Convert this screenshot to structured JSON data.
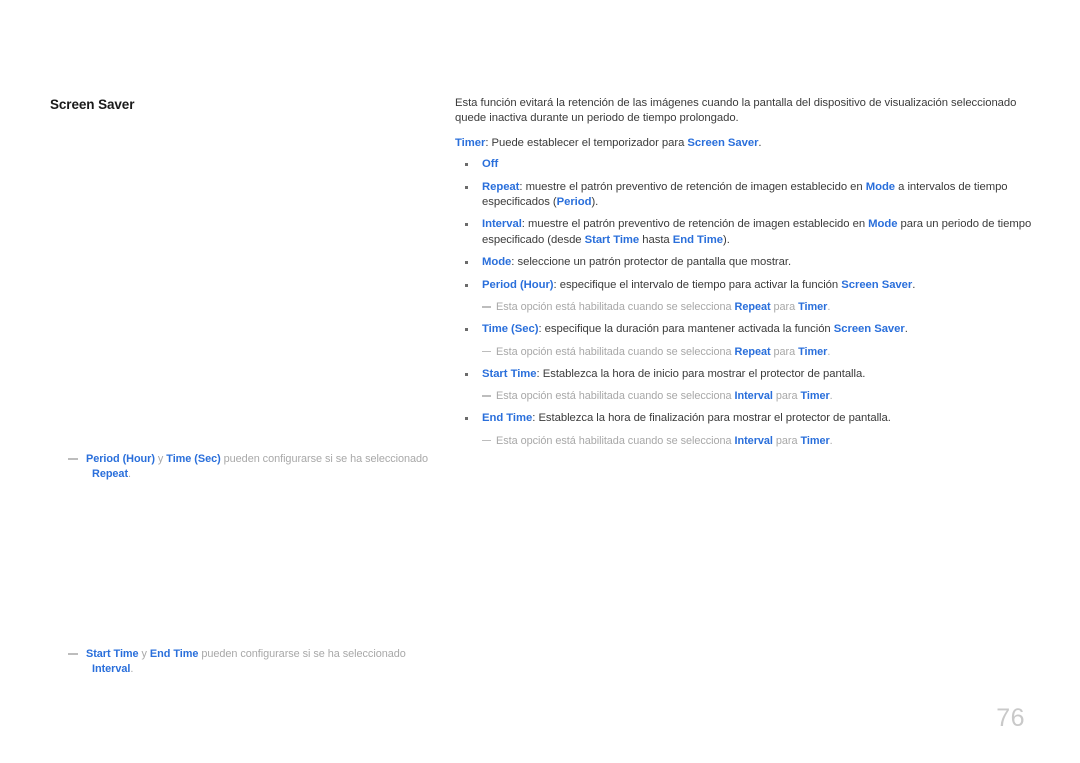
{
  "page": {
    "number": "76",
    "accent_color": "#2a6fdb",
    "body_color": "#3b3b3b",
    "note_color": "#a8a8a8"
  },
  "section": {
    "title": "Screen Saver"
  },
  "intro": {
    "text": "Esta función evitará la retención de las imágenes cuando la pantalla del dispositivo de visualización seleccionado quede inactiva durante un periodo de tiempo prolongado."
  },
  "timer": {
    "term": "Timer",
    "sep": ": ",
    "text_before": "Puede establecer el temporizador para ",
    "ref": "Screen Saver",
    "text_after": "."
  },
  "options": [
    {
      "term": "Off",
      "sep": "",
      "body_1": "",
      "ref_1": "",
      "body_2": "",
      "ref_2": "",
      "body_3": ""
    },
    {
      "term": "Repeat",
      "sep": ": ",
      "body_1": "muestre el patrón preventivo de retención de imagen establecido en ",
      "ref_1": "Mode",
      "body_2": " a intervalos de tiempo especificados (",
      "ref_2": "Period",
      "body_3": ")."
    },
    {
      "term": "Interval",
      "sep": ": ",
      "body_1": "muestre el patrón preventivo de retención de imagen establecido en ",
      "ref_1": "Mode",
      "body_2": " para un periodo de tiempo especificado (desde ",
      "ref_2": "Start Time",
      "body_3": " hasta ",
      "ref_3": "End Time",
      "body_4": ")."
    },
    {
      "term": "Mode",
      "sep": ": ",
      "body_1": "seleccione un patrón protector de pantalla que mostrar.",
      "ref_1": "",
      "body_2": ""
    },
    {
      "term": "Period (Hour)",
      "sep": ": ",
      "body_1": "especifique el intervalo de tiempo para activar la función ",
      "ref_1": "Screen Saver",
      "body_2": "."
    },
    {
      "term": "Time (Sec)",
      "sep": ": ",
      "body_1": "especifique la duración para mantener activada la función ",
      "ref_1": "Screen Saver",
      "body_2": "."
    },
    {
      "term": "Start Time",
      "sep": ": ",
      "body_1": "Establezca la hora de inicio para mostrar el protector de pantalla.",
      "ref_1": "",
      "body_2": ""
    },
    {
      "term": "End Time",
      "sep": ": ",
      "body_1": "Establezca la hora de finalización para mostrar el protector de pantalla.",
      "ref_1": "",
      "body_2": ""
    }
  ],
  "inline_notes": {
    "repeat_note": {
      "prefix": "Esta opción está habilitada cuando se selecciona ",
      "ref_1": "Repeat",
      "middle": " para ",
      "ref_2": "Timer",
      "suffix": "."
    },
    "interval_note": {
      "prefix": "Esta opción está habilitada cuando se selecciona ",
      "ref_1": "Interval",
      "middle": " para ",
      "ref_2": "Timer",
      "suffix": "."
    }
  },
  "left_notes": [
    {
      "ref_1": "Period (Hour)",
      "joiner": " y ",
      "ref_2": "Time (Sec)",
      "body": " pueden configurarse si se ha seleccionado",
      "ref_3": "Repeat",
      "tail": "."
    },
    {
      "ref_1": "Start Time",
      "joiner": " y ",
      "ref_2": "End Time",
      "body": " pueden configurarse si se ha seleccionado",
      "ref_3": "Interval",
      "tail": "."
    }
  ]
}
